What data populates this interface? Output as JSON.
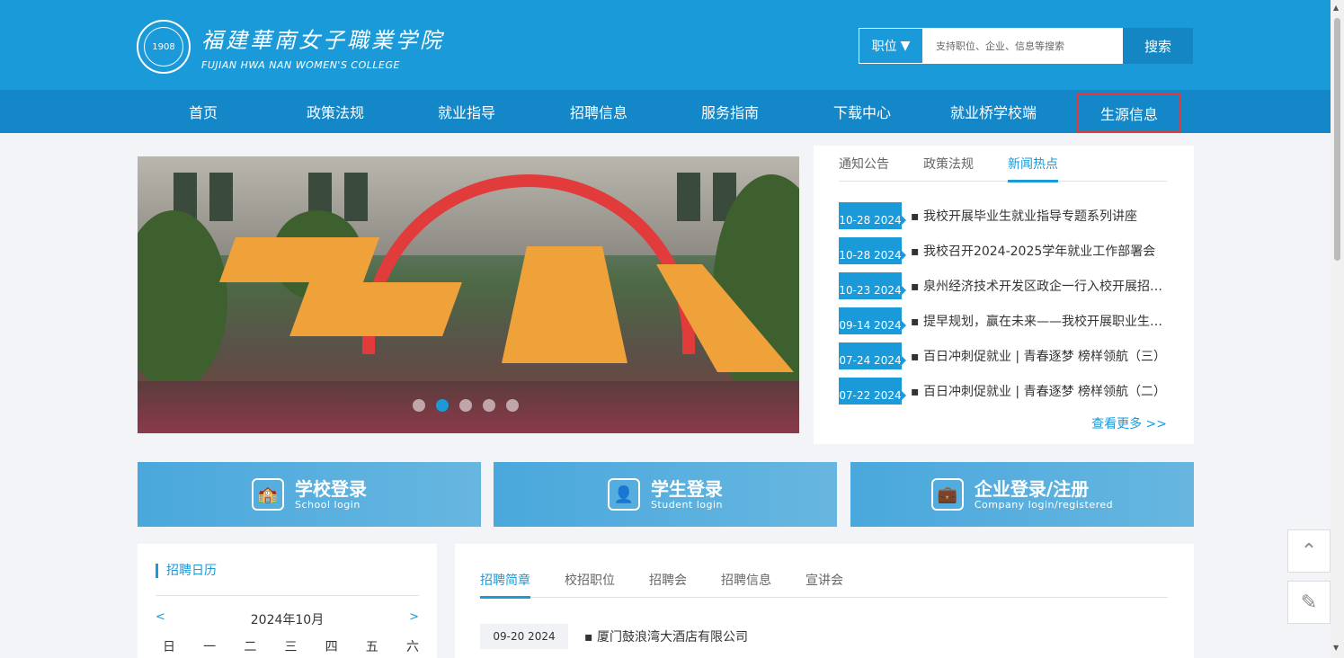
{
  "header": {
    "logo_cn": "福建華南女子職業学院",
    "logo_en": "FUJIAN HWA NAN WOMEN'S COLLEGE",
    "seal_year": "1908",
    "search_type": "职位",
    "search_placeholder": "支持职位、企业、信息等搜索",
    "search_button": "搜索"
  },
  "nav": [
    {
      "label": "首页"
    },
    {
      "label": "政策法规"
    },
    {
      "label": "就业指导"
    },
    {
      "label": "招聘信息"
    },
    {
      "label": "服务指南"
    },
    {
      "label": "下载中心"
    },
    {
      "label": "就业桥学校端"
    },
    {
      "label": "生源信息"
    }
  ],
  "news": {
    "tabs": [
      "通知公告",
      "政策法规",
      "新闻热点"
    ],
    "active_tab": "新闻热点",
    "items": [
      {
        "date": "10-28 2024",
        "title": "我校开展毕业生就业指导专题系列讲座"
      },
      {
        "date": "10-28 2024",
        "title": "我校召开2024-2025学年就业工作部署会"
      },
      {
        "date": "10-23 2024",
        "title": "泉州经济技术开发区政企一行入校开展招聘..."
      },
      {
        "date": "09-14 2024",
        "title": "提早规划，赢在未来——我校开展职业生涯..."
      },
      {
        "date": "07-24 2024",
        "title": "百日冲刺促就业 | 青春逐梦 榜样领航（三）"
      },
      {
        "date": "07-22 2024",
        "title": "百日冲刺促就业 | 青春逐梦 榜样领航（二）"
      }
    ],
    "more": "查看更多 >>"
  },
  "login": [
    {
      "title": "学校登录",
      "sub": "School login",
      "icon": "school-icon"
    },
    {
      "title": "学生登录",
      "sub": "Student login",
      "icon": "student-icon"
    },
    {
      "title": "企业登录/注册",
      "sub": "Company login/registered",
      "icon": "briefcase-icon"
    }
  ],
  "calendar": {
    "title": "招聘日历",
    "prev": "<",
    "next": ">",
    "month": "2024年10月",
    "weekdays": [
      "日",
      "一",
      "二",
      "三",
      "四",
      "五",
      "六"
    ]
  },
  "recruit": {
    "tabs": [
      "招聘简章",
      "校招职位",
      "招聘会",
      "招聘信息",
      "宣讲会"
    ],
    "active_tab": "招聘简章",
    "items": [
      {
        "date": "09-20 2024",
        "title": "厦门鼓浪湾大酒店有限公司"
      }
    ]
  },
  "colors": {
    "primary": "#1a9ad9",
    "nav": "#1487c9",
    "highlight": "#e53935"
  }
}
